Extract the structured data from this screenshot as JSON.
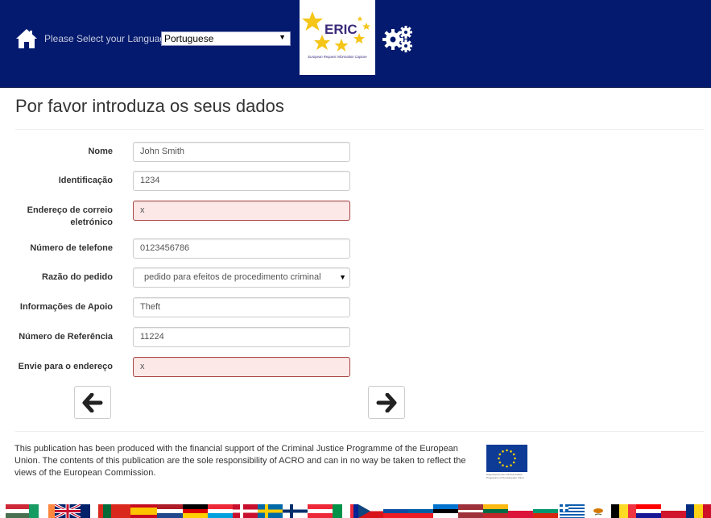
{
  "header": {
    "language_label": "Please Select your Language",
    "language_selected": "Portuguese",
    "logo": {
      "title": "ERIC",
      "subtitle": "European Request Information Capture"
    },
    "colors": {
      "background": "#031a6e",
      "logo_text": "#3b2a7a",
      "logo_star": "#f5c518"
    }
  },
  "page": {
    "title": "Por favor introduza os seus dados"
  },
  "form": {
    "fields": [
      {
        "label": "Nome",
        "value": "John Smith",
        "type": "text",
        "error": false
      },
      {
        "label": "Identificação",
        "value": "1234",
        "type": "text",
        "error": false
      },
      {
        "label": "Endereço de correio eletrónico",
        "value": "x",
        "type": "text",
        "error": true
      },
      {
        "label": "Número de telefone",
        "value": "0123456786",
        "type": "text",
        "error": false
      },
      {
        "label": "Razão do pedido",
        "value": "pedido para efeitos de procedimento criminal",
        "type": "select",
        "error": false
      },
      {
        "label": "Informações de Apoio",
        "value": "Theft",
        "type": "text",
        "error": false
      },
      {
        "label": "Número de Referência",
        "value": "11224",
        "type": "text",
        "error": false
      },
      {
        "label": "Envie para o endereço",
        "value": "x",
        "type": "text",
        "error": true
      }
    ],
    "error_color": "#a94442",
    "error_background": "#fde8e8"
  },
  "navigation": {
    "prev_icon": "arrow-left-icon",
    "next_icon": "arrow-right-icon"
  },
  "footer": {
    "disclaimer": "This publication has been produced with the financial support of the Criminal Justice Programme of the European Union. The contents of this publication are the sole responsibility of ACRO and can in no way be taken to reflect the views of the European Commission.",
    "eu_caption": "Supported by the Criminal Justice Programme of the European Union"
  },
  "flags": [
    "hungary",
    "ireland",
    "united-kingdom",
    "portugal",
    "spain",
    "netherlands",
    "germany",
    "luxembourg",
    "denmark",
    "sweden",
    "finland",
    "austria",
    "italy",
    "france",
    "czech-republic",
    "slovakia",
    "slovenia",
    "estonia",
    "latvia",
    "lithuania",
    "poland",
    "bulgaria",
    "greece",
    "cyprus",
    "belgium",
    "croatia",
    "malta",
    "romania"
  ]
}
